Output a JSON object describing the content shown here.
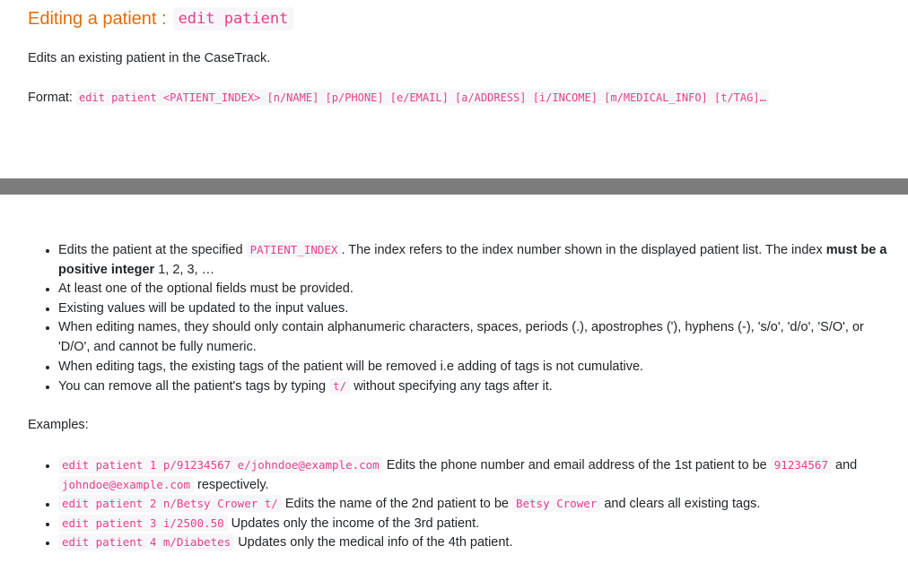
{
  "heading": {
    "text": "Editing a patient :",
    "command": "edit patient"
  },
  "intro": "Edits an existing patient in the CaseTrack.",
  "format": {
    "label": "Format:",
    "syntax": "edit patient <PATIENT_INDEX> [n/NAME] [p/PHONE] [e/EMAIL] [a/ADDRESS] [i/INCOME] [m/MEDICAL_INFO] [t/TAG]…"
  },
  "notes": [
    {
      "pre": "Edits the patient at the specified",
      "code": "PATIENT_INDEX",
      "mid": ". The index refers to the index number shown in the displayed patient list. The index",
      "bold": "must be a positive integer",
      "post": "1, 2, 3, …"
    },
    {
      "text": "At least one of the optional fields must be provided."
    },
    {
      "text": "Existing values will be updated to the input values."
    },
    {
      "text": "When editing names, they should only contain alphanumeric characters, spaces, periods (.), apostrophes ('), hyphens (-), 's/o', 'd/o', 'S/O', or 'D/O', and cannot be fully numeric."
    },
    {
      "text": "When editing tags, the existing tags of the patient will be removed i.e adding of tags is not cumulative."
    },
    {
      "pre": "You can remove all the patient's tags by typing",
      "code": "t/",
      "post": "without specifying any tags after it."
    }
  ],
  "examples_label": "Examples:",
  "examples": [
    {
      "code": "edit patient 1 p/91234567 e/johndoe@example.com",
      "pre": "Edits the phone number and email address of the 1st patient to be",
      "code2": "91234567",
      "mid": "and",
      "code3": "johndoe@example.com",
      "post": "respectively."
    },
    {
      "code": "edit patient 2 n/Betsy Crower t/",
      "pre": "Edits the name of the 2nd patient to be",
      "code2": "Betsy Crower",
      "post": "and clears all existing tags."
    },
    {
      "code": "edit patient 3 i/2500.50",
      "pre": "Updates only the income of the 3rd patient."
    },
    {
      "code": "edit patient 4 m/Diabetes",
      "pre": "Updates only the medical info of the 4th patient."
    }
  ]
}
